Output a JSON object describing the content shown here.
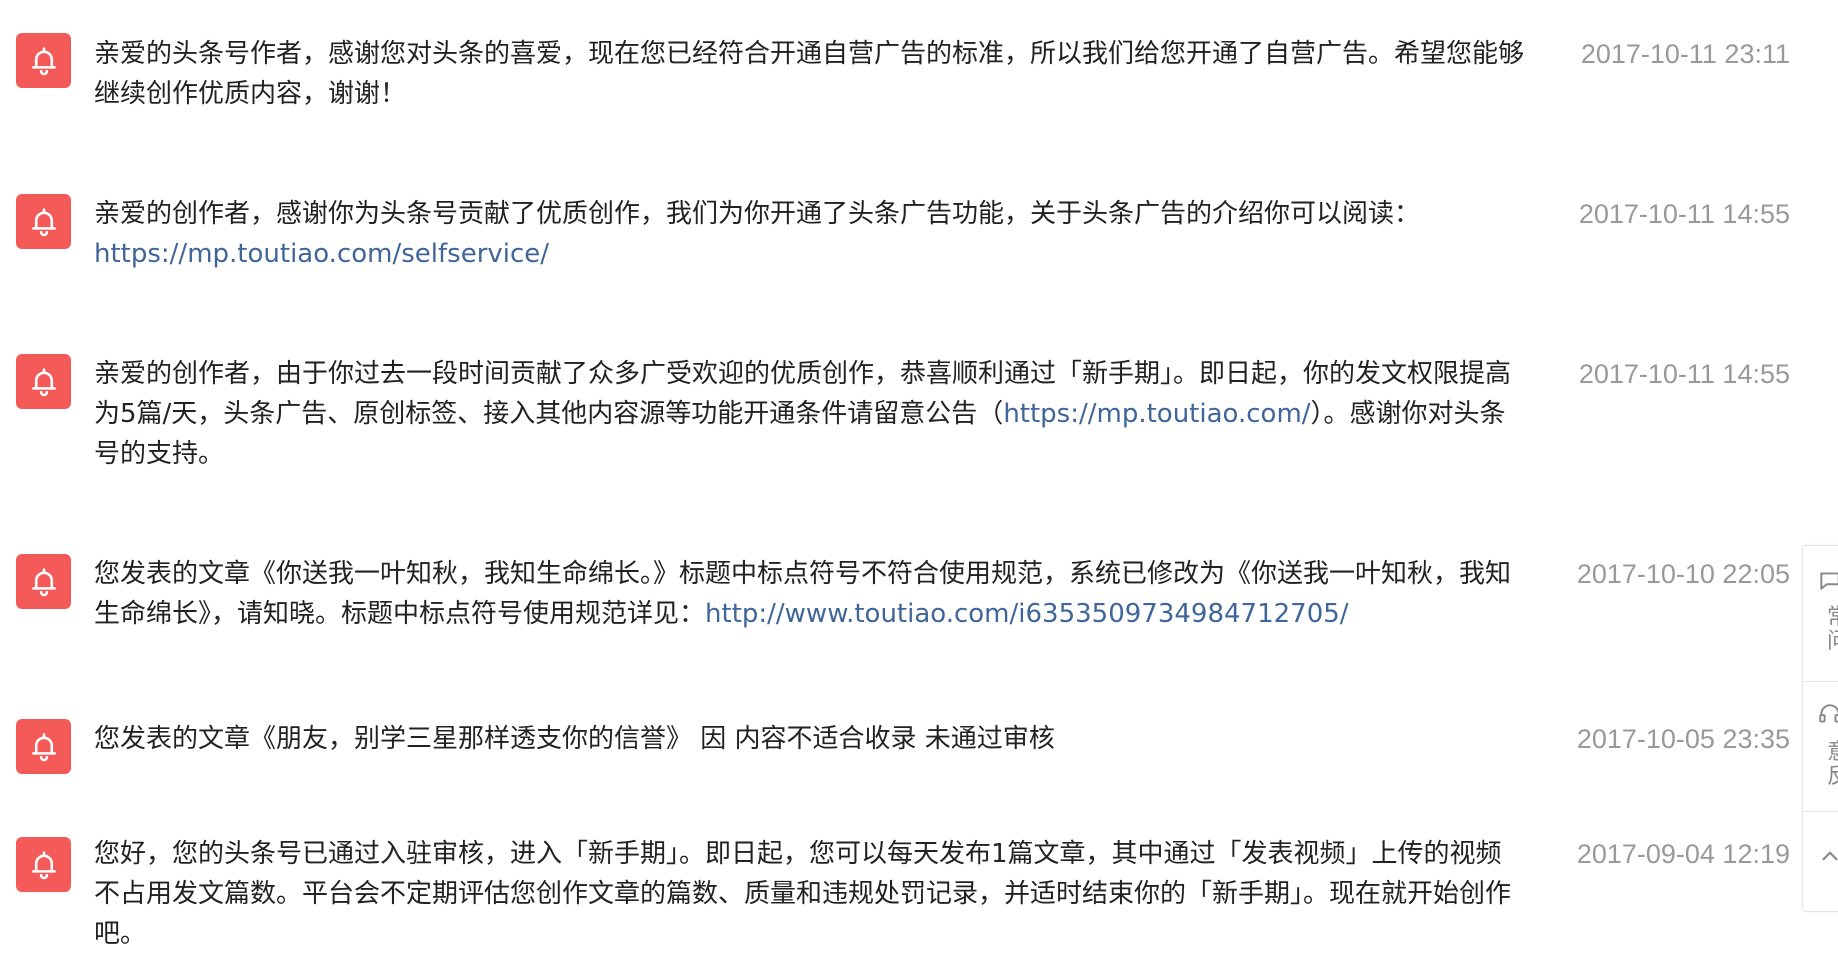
{
  "colors": {
    "bell_badge": "#f35a58",
    "link": "#406599",
    "timestamp": "#999999",
    "text": "#222222"
  },
  "notices": [
    {
      "icon": "bell-icon",
      "text": "亲爱的头条号作者，感谢您对头条的喜爱，现在您已经符合开通自营广告的标准，所以我们给您开通了自营广告。希望您能够继续创作优质内容，谢谢！",
      "time": "2017-10-11 23:11"
    },
    {
      "icon": "bell-icon",
      "text": "亲爱的创作者，感谢你为头条号贡献了优质创作，我们为你开通了头条广告功能，关于头条广告的介绍你可以阅读：",
      "link": "https://mp.toutiao.com/selfservice/",
      "time": "2017-10-11 14:55"
    },
    {
      "icon": "bell-icon",
      "text": "亲爱的创作者，由于你过去一段时间贡献了众多广受欢迎的优质创作，恭喜顺利通过「新手期」。即日起，你的发文权限提高为5篇/天，头条广告、原创标签、接入其他内容源等功能开通条件请留意公告（",
      "link": "https://mp.toutiao.com/",
      "text_after": "）。感谢你对头条号的支持。",
      "time": "2017-10-11 14:55"
    },
    {
      "icon": "bell-icon",
      "text": "您发表的文章《你送我一叶知秋，我知生命绵长。》标题中标点符号不符合使用规范，系统已修改为《你送我一叶知秋，我知生命绵长》，请知晓。标题中标点符号使用规范详见：",
      "link": "http://www.toutiao.com/i6353509734984712705/",
      "time": "2017-10-10 22:05"
    },
    {
      "icon": "bell-icon",
      "text": "您发表的文章《朋友，别学三星那样透支你的信誉》 因 内容不适合收录 未通过审核",
      "time": "2017-10-05 23:35"
    },
    {
      "icon": "bell-icon",
      "text": "您好，您的头条号已通过入驻审核，进入「新手期」。即日起，您可以每天发布1篇文章，其中通过「发表视频」上传的视频不占用发文篇数。平台会不定期评估您创作文章的篇数、质量和违规处罚记录，并适时结束你的「新手期」。现在就开始创作吧。",
      "time": "2017-09-04 12:19"
    }
  ],
  "side_panel": {
    "items": [
      {
        "icon": "chat-bubble-icon",
        "label": "常问"
      },
      {
        "icon": "headset-icon",
        "label": "意反"
      },
      {
        "icon": "arrow-up-icon",
        "label": ""
      }
    ]
  }
}
